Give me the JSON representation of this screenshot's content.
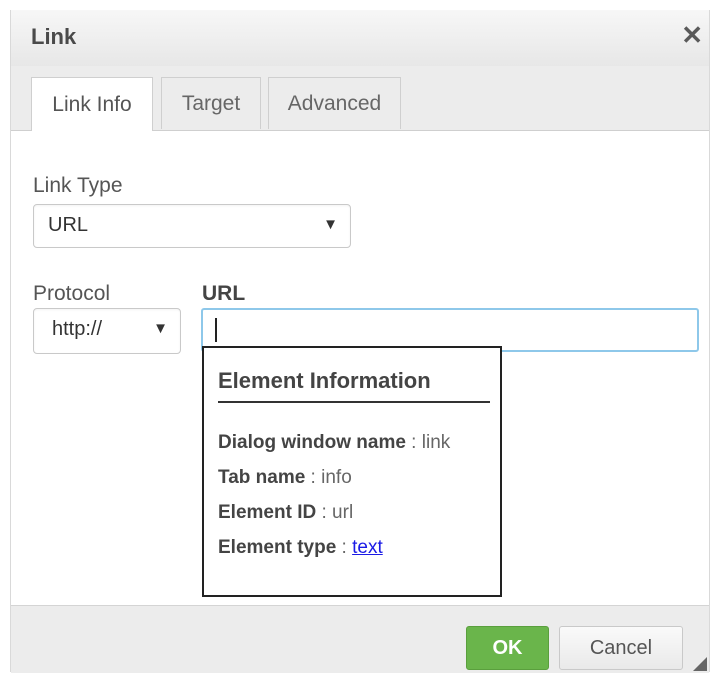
{
  "dialog": {
    "title": "Link",
    "close_glyph": "✕",
    "close_icon": "close-icon"
  },
  "tabs": [
    {
      "label": "Link Info",
      "active": true
    },
    {
      "label": "Target",
      "active": false
    },
    {
      "label": "Advanced",
      "active": false
    }
  ],
  "link_type": {
    "label": "Link Type",
    "value": "URL",
    "arrow": "▼"
  },
  "protocol": {
    "label": "Protocol",
    "value": "http://",
    "arrow": "▼"
  },
  "url": {
    "label": "URL",
    "value": ""
  },
  "tooltip": {
    "title": "Element Information",
    "rows": [
      {
        "key": "Dialog window name",
        "sep": " : ",
        "value": "link"
      },
      {
        "key": "Tab name",
        "sep": " : ",
        "value": "info"
      },
      {
        "key": "Element ID",
        "sep": " : ",
        "value": "url"
      },
      {
        "key": "Element type",
        "sep": " : ",
        "value": "text"
      }
    ]
  },
  "footer": {
    "ok_label": "OK",
    "cancel_label": "Cancel"
  },
  "colors": {
    "ok_button": "#6ab54b",
    "focus_border": "#8ec8ea",
    "link": "#1a1ae6"
  }
}
